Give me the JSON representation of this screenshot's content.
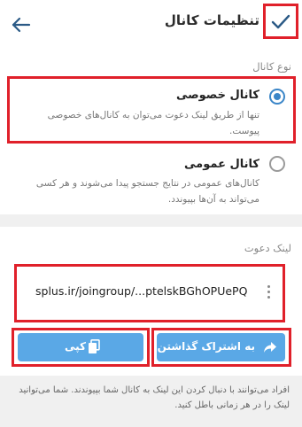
{
  "header": {
    "title": "تنظیمات کانال"
  },
  "channel_type": {
    "section_label": "نوع کانال",
    "options": [
      {
        "title": "کانال خصوصی",
        "description": "تنها از طریق لینک دعوت می‌توان به کانال‌های خصوصی پیوست.",
        "selected": true
      },
      {
        "title": "کانال عمومی",
        "description": "کانال‌های عمومی در نتایج جستجو پیدا می‌شوند و هر کسی می‌تواند به آن‌ها بپیوندد.",
        "selected": false
      }
    ]
  },
  "invite": {
    "section_label": "لینک دعوت",
    "link": "splus.ir/joingroup/...ptelskBGhOPUePQ",
    "copy_label": "کپی",
    "share_label": "به اشتراک گذاشتن",
    "footer": "افراد می‌توانند با دنبال کردن این لینک به کانال شما بپیوندند. شما می‌توانید لینک را در هر زمانی باطل کنید."
  },
  "colors": {
    "accent": "#3b86c8",
    "button": "#5aa8e6",
    "highlight": "#e0202a"
  }
}
